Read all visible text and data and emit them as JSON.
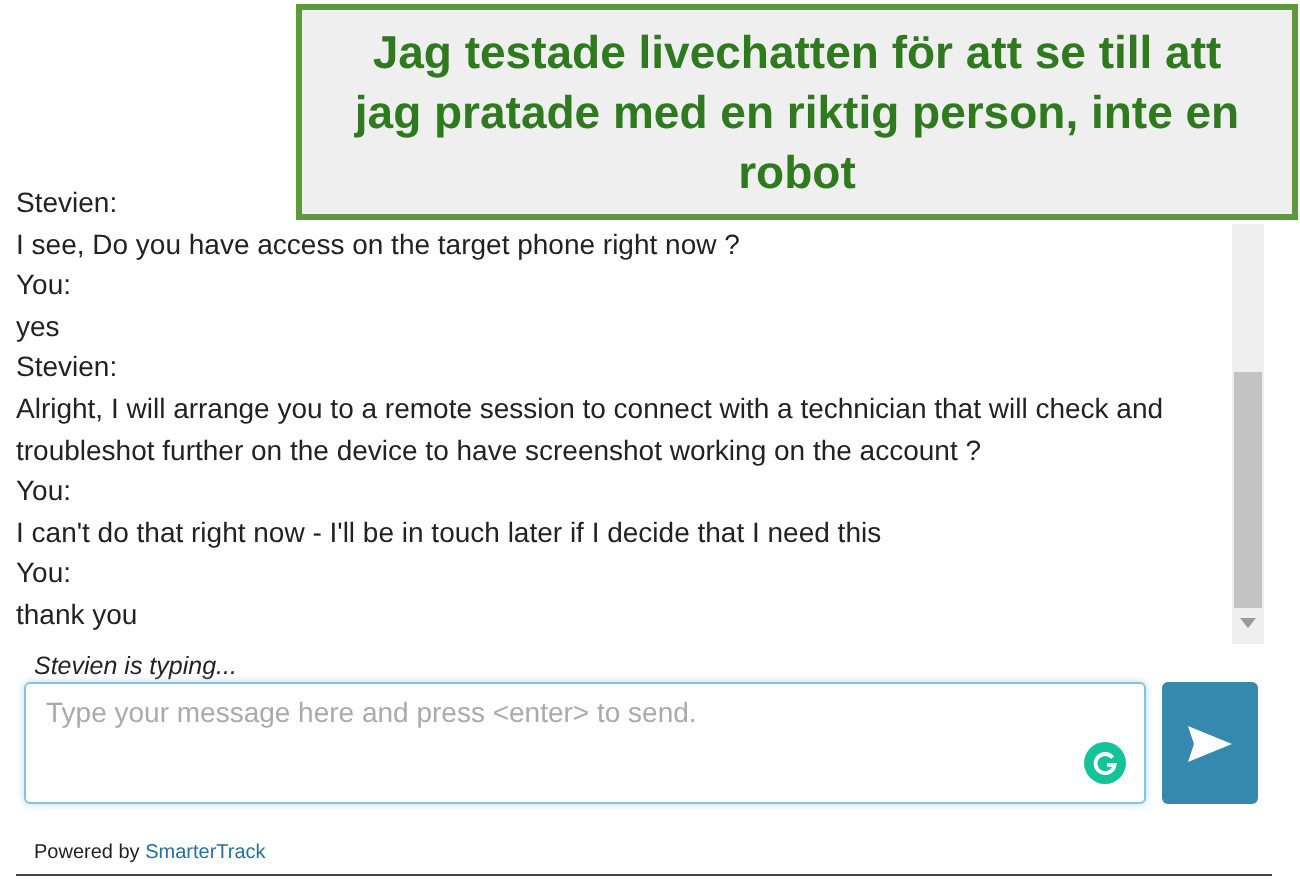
{
  "annotation": {
    "text": "Jag testade livechatten för att se till att jag pratade med en riktig person, inte en robot"
  },
  "messages": [
    {
      "author": "Stevien:",
      "text": "I see, Do you have access on the target phone right now ?"
    },
    {
      "author": "You:",
      "text": "yes"
    },
    {
      "author": "Stevien:",
      "text": "Alright, I will arrange you to a remote session to connect with a technician that will check and troubleshot further on the device to have screenshot working on the account ?"
    },
    {
      "author": "You:",
      "text": "I can't do that right now - I'll be in touch later if I decide that I need this"
    },
    {
      "author": "You:",
      "text": "thank you"
    }
  ],
  "typing": "Stevien is typing...",
  "composer": {
    "placeholder": "Type your message here and press <enter> to send."
  },
  "footer": {
    "prefix": "Powered by",
    "link": "SmarterTrack"
  }
}
